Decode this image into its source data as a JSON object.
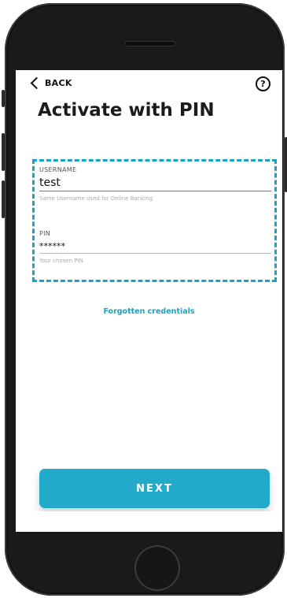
{
  "header": {
    "back_label": "BACK",
    "help_icon": "question-circle-icon",
    "help_glyph": "?"
  },
  "page": {
    "title": "Activate with PIN"
  },
  "form": {
    "username": {
      "label": "USERNAME",
      "value": "test",
      "hint": "Same Username used for Online Banking"
    },
    "pin": {
      "label": "PIN",
      "value": "******",
      "hint": "Your chosen PIN"
    },
    "highlight_color": "#1aa2c4"
  },
  "links": {
    "forgotten": "Forgotten credentials"
  },
  "actions": {
    "next_label": "NEXT",
    "accent": "#22aacb"
  }
}
